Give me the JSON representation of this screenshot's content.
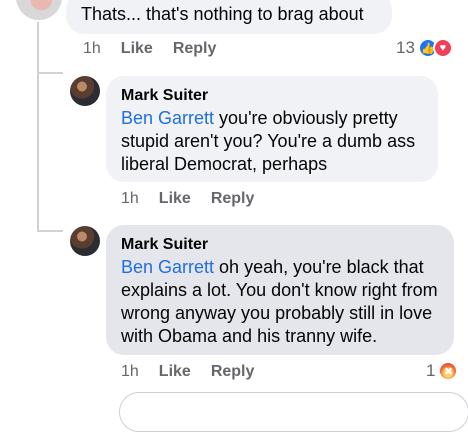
{
  "comment1": {
    "text": "Thats... that's nothing to brag about",
    "time": "1h",
    "like": "Like",
    "reply": "Reply",
    "reaction_count": "13"
  },
  "reply1": {
    "author": "Mark Suiter",
    "mention": "Ben Garrett",
    "text": " you're obviously pretty stupid aren't you? You're a dumb ass liberal Democrat, perhaps",
    "time": "1h",
    "like": "Like",
    "reply": "Reply"
  },
  "reply2": {
    "author": "Mark Suiter",
    "mention": "Ben Garrett",
    "text": " oh yeah, you're black that explains a lot. You don't know right from wrong anyway you probably still in love with Obama and his tranny wife.",
    "time": "1h",
    "like": "Like",
    "reply": "Reply",
    "reaction_count": "1"
  },
  "colors": {
    "mention": "#216fdb",
    "like_reaction": "#1877f2",
    "love_reaction": "#f33e58",
    "angry_reaction": "#e5331e"
  }
}
